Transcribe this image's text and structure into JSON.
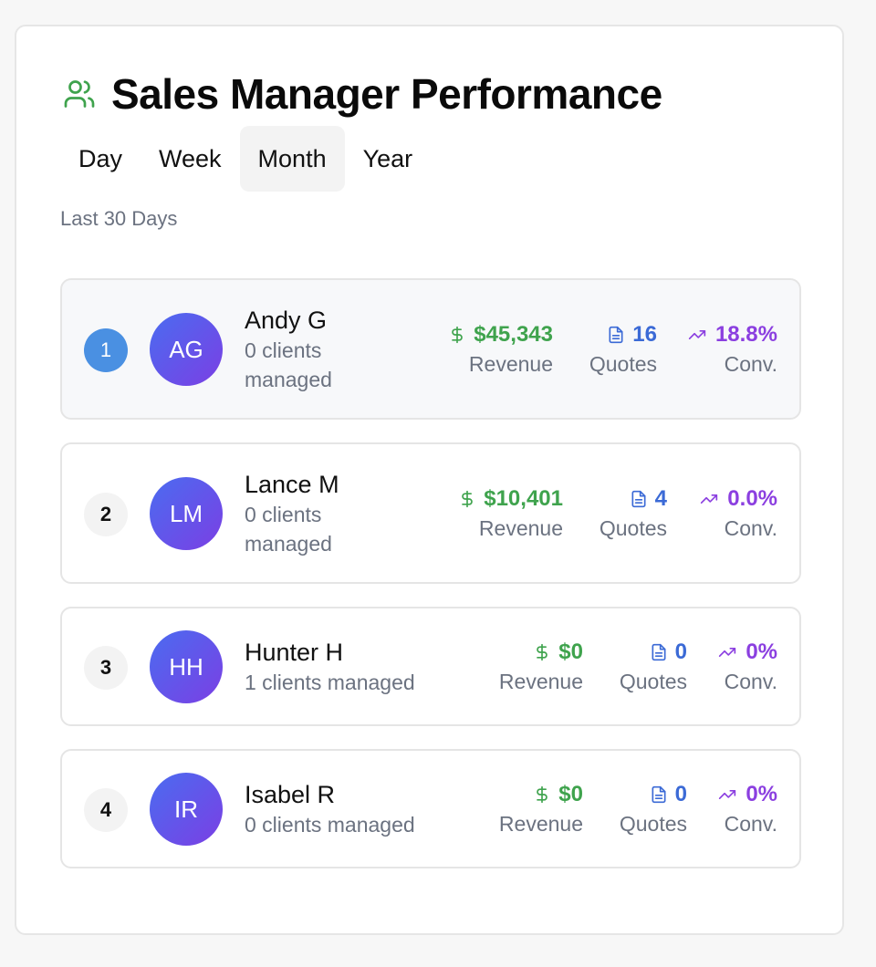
{
  "header": {
    "title": "Sales Manager Performance",
    "icon": "users-icon",
    "accent": "#3fa34d"
  },
  "tabs": [
    {
      "label": "Day",
      "active": false
    },
    {
      "label": "Week",
      "active": false
    },
    {
      "label": "Month",
      "active": true
    },
    {
      "label": "Year",
      "active": false
    }
  ],
  "period_label": "Last 30 Days",
  "managers": [
    {
      "rank": "1",
      "initials": "AG",
      "name": "Andy G",
      "clients": "0 clients managed",
      "revenue": "$45,343",
      "revenue_label": "Revenue",
      "quotes": "16",
      "quotes_label": "Quotes",
      "conv": "18.8%",
      "conv_label": "Conv."
    },
    {
      "rank": "2",
      "initials": "LM",
      "name": "Lance M",
      "clients": "0 clients managed",
      "revenue": "$10,401",
      "revenue_label": "Revenue",
      "quotes": "4",
      "quotes_label": "Quotes",
      "conv": "0.0%",
      "conv_label": "Conv."
    },
    {
      "rank": "3",
      "initials": "HH",
      "name": "Hunter H",
      "clients": "1 clients managed",
      "revenue": "$0",
      "revenue_label": "Revenue",
      "quotes": "0",
      "quotes_label": "Quotes",
      "conv": "0%",
      "conv_label": "Conv."
    },
    {
      "rank": "4",
      "initials": "IR",
      "name": "Isabel R",
      "clients": "0 clients managed",
      "revenue": "$0",
      "revenue_label": "Revenue",
      "quotes": "0",
      "quotes_label": "Quotes",
      "conv": "0%",
      "conv_label": "Conv."
    }
  ],
  "colors": {
    "revenue": "#3fa34d",
    "quotes": "#3b6ad6",
    "conversion": "#8b3fe0",
    "rank_top": "#4a90e2",
    "avatar_from": "#4a6cf0",
    "avatar_to": "#7b3fe4"
  }
}
